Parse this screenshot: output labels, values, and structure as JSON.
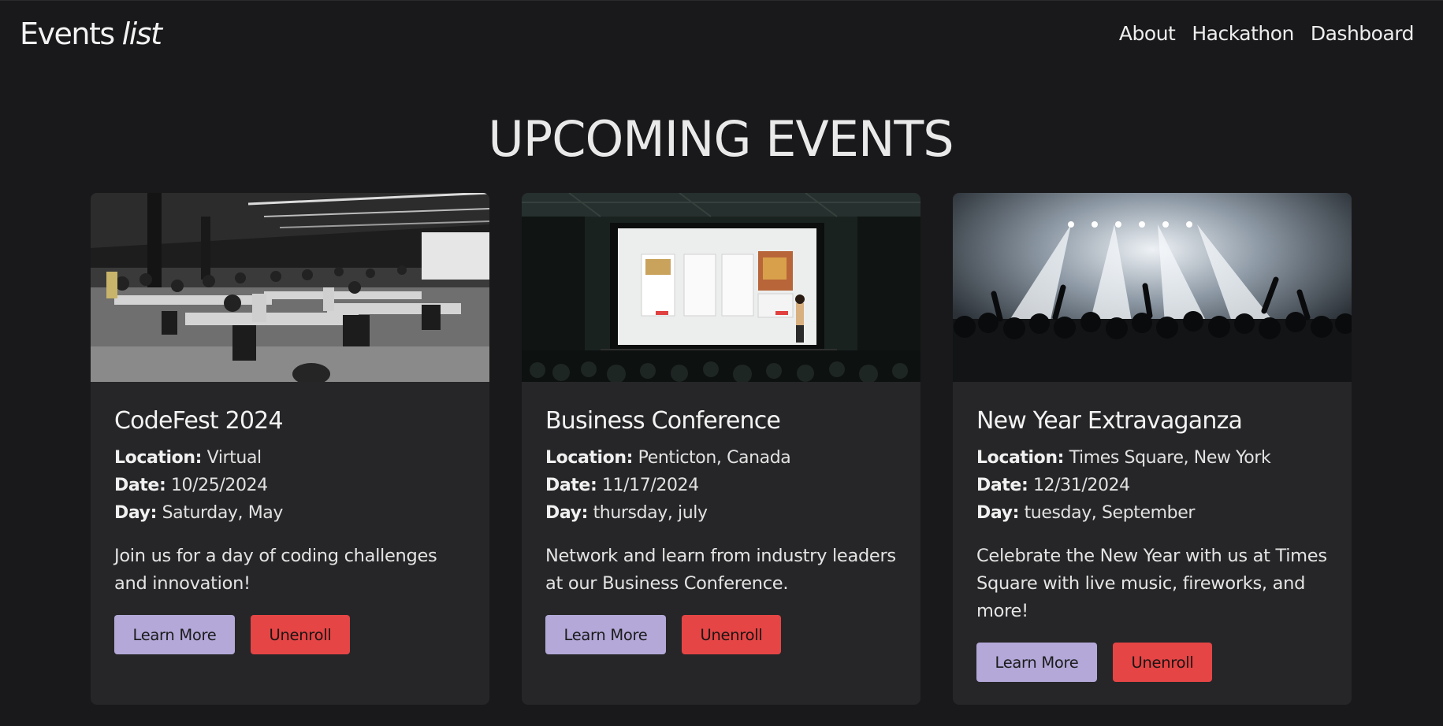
{
  "brand": {
    "name": "Events",
    "name_italic": "list"
  },
  "nav": {
    "links": [
      "About",
      "Hackathon",
      "Dashboard"
    ]
  },
  "page": {
    "title": "UPCOMING EVENTS"
  },
  "labels": {
    "location": "Location:",
    "date": "Date:",
    "day": "Day:"
  },
  "cards": [
    {
      "title": "CodeFest 2024",
      "location": "Virtual",
      "date": "10/25/2024",
      "day": "Saturday, May",
      "description": "Join us for a day of coding challenges and innovation!",
      "learn_more": "Learn More",
      "unenroll": "Unenroll"
    },
    {
      "title": "Business Conference",
      "location": "Penticton, Canada",
      "date": "11/17/2024",
      "day": "thursday, july",
      "description": "Network and learn from industry leaders at our Business Conference.",
      "learn_more": "Learn More",
      "unenroll": "Unenroll"
    },
    {
      "title": "New Year Extravaganza",
      "location": "Times Square, New York",
      "date": "12/31/2024",
      "day": "tuesday, September",
      "description": "Celebrate the New Year with us at Times Square with live music, fireworks, and more!",
      "learn_more": "Learn More",
      "unenroll": "Unenroll"
    }
  ],
  "colors": {
    "background": "#19191b",
    "card": "#262628",
    "learn_more_button": "#b3a8d8",
    "unenroll_button": "#e54545"
  }
}
